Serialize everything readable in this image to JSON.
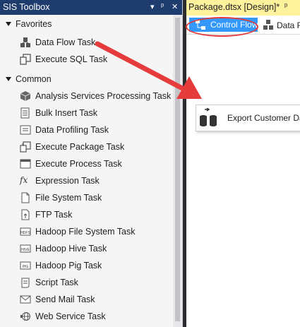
{
  "toolbox": {
    "title": "SSIS Toolbox",
    "title_visible": "SIS Toolbox",
    "sections": {
      "favorites": {
        "label": "Favorites",
        "items": [
          {
            "label": "Data Flow Task",
            "icon": "data-flow-task-icon"
          },
          {
            "label": "Execute SQL Task",
            "icon": "execute-sql-task-icon"
          }
        ]
      },
      "common": {
        "label": "Common",
        "items": [
          {
            "label": "Analysis Services Processing Task",
            "icon": "cube-icon"
          },
          {
            "label": "Bulk Insert Task",
            "icon": "bulk-insert-icon"
          },
          {
            "label": "Data Profiling Task",
            "icon": "data-profiling-icon"
          },
          {
            "label": "Execute Package Task",
            "icon": "execute-package-icon"
          },
          {
            "label": "Execute Process Task",
            "icon": "execute-process-icon"
          },
          {
            "label": "Expression Task",
            "icon": "fx-icon"
          },
          {
            "label": "File System Task",
            "icon": "file-system-icon"
          },
          {
            "label": "FTP Task",
            "icon": "ftp-icon"
          },
          {
            "label": "Hadoop File System Task",
            "icon": "hdfs-icon"
          },
          {
            "label": "Hadoop Hive Task",
            "icon": "hive-icon"
          },
          {
            "label": "Hadoop Pig Task",
            "icon": "pig-icon"
          },
          {
            "label": "Script Task",
            "icon": "script-icon"
          },
          {
            "label": "Send Mail Task",
            "icon": "mail-icon"
          },
          {
            "label": "Web Service Task",
            "icon": "web-service-icon"
          }
        ]
      }
    }
  },
  "designer": {
    "tab_title": "Package.dtsx [Design]*",
    "subtabs": {
      "control_flow": "Control Flow",
      "data_flow": "Data F"
    },
    "task": {
      "label": "Export Customer Data"
    }
  },
  "colors": {
    "title_bar": "#1e3c6e",
    "selected_tab": "#3399ff",
    "annotation": "#e53b3b",
    "doc_tab": "#fff29d"
  }
}
